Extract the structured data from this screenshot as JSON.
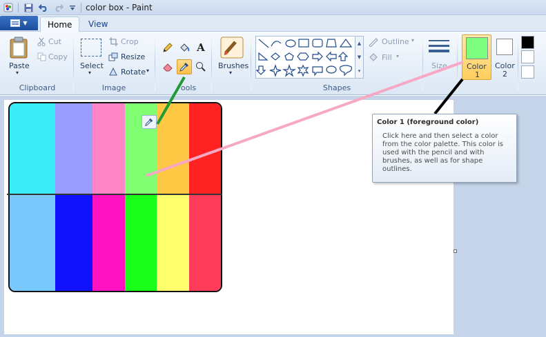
{
  "window": {
    "title": "color box - Paint"
  },
  "quick_access": {
    "icons": [
      "paint-app-icon",
      "save-icon",
      "undo-icon",
      "redo-icon",
      "customize-icon"
    ]
  },
  "tabs": {
    "app_menu": "▼",
    "home": "Home",
    "view": "View"
  },
  "clipboard": {
    "paste": "Paste",
    "cut": "Cut",
    "copy": "Copy",
    "label": "Clipboard"
  },
  "image": {
    "select": "Select",
    "crop": "Crop",
    "resize": "Resize",
    "rotate": "Rotate",
    "label": "Image"
  },
  "tools": {
    "label": "ools"
  },
  "brushes": {
    "label": "Brushes"
  },
  "shapes": {
    "outline": "Outline",
    "fill": "Fill",
    "label": "Shapes"
  },
  "size": {
    "label": "Size"
  },
  "colors": {
    "color1_label_line1": "Color",
    "color1_label_line2": "1",
    "color2_label_line1": "Color",
    "color2_label_line2": "2",
    "color1_value": "#7fff7f",
    "color2_value": "#ffffff",
    "palette": [
      "#000000",
      "#ffffff",
      "#ffffff"
    ]
  },
  "tooltip": {
    "title": "Color 1 (foreground color)",
    "body": "Click here and then select a color from the color palette. This color is used with the pencil  and with brushes, as well as for shape outlines."
  },
  "canvas": {
    "color_box": {
      "top_row": [
        "#3aedf8",
        "#9a9cfe",
        "#ff86c4",
        "#81fe72",
        "#ffc844",
        "#ff2222"
      ],
      "bottom_row": [
        "#78c8fc",
        "#1111fe",
        "#ff12c0",
        "#1aff1a",
        "#ffff6e",
        "#ff3d5a"
      ]
    }
  },
  "annotations": {
    "pink_line": "#f7a8c4",
    "green_line": "#1f9a36",
    "black_line": "#000000"
  }
}
